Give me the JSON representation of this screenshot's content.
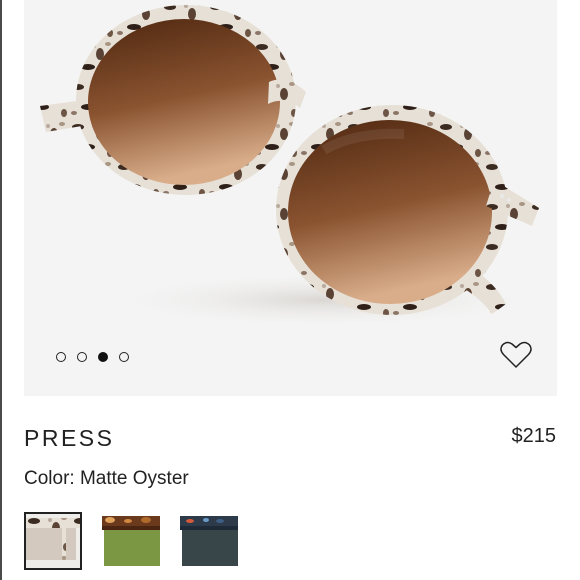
{
  "product": {
    "name": "PRESS",
    "price": "$215",
    "color_label": "Color:",
    "color_value": "Matte Oyster"
  },
  "gallery": {
    "image_count": 4,
    "active_index": 2,
    "favorite_icon": "heart-outline-icon"
  },
  "variants": [
    {
      "name": "Matte Oyster",
      "selected": true,
      "frame": "#d8d0c6",
      "lens": "#c5b8ad"
    },
    {
      "name": "Tortoise / Green",
      "selected": false,
      "frame": "#6b3a1c",
      "lens": "#6f8a3a"
    },
    {
      "name": "Blue Tortoise / Grey",
      "selected": false,
      "frame": "#2c3a4a",
      "lens": "#2d3a3e"
    }
  ],
  "colors": {
    "background": "#f4f4f4",
    "text": "#222222",
    "frame_base": "#e6dfd5",
    "frame_spots": "#4a3a2c",
    "lens_top": "#5a2e16",
    "lens_bottom": "#c89a78"
  }
}
